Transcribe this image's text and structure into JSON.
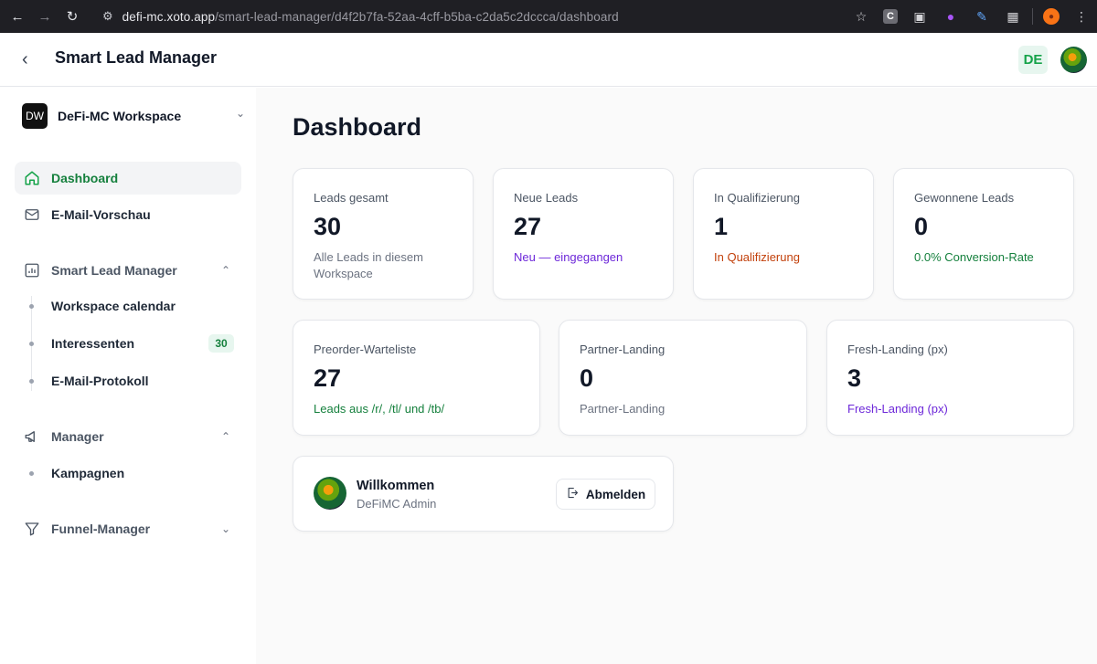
{
  "browser": {
    "url_host": "defi-mc.xoto.app",
    "url_path": "/smart-lead-manager/d4f2b7fa-52aa-4cff-b5ba-c2da5c2dccca/dashboard"
  },
  "header": {
    "title": "Smart Lead Manager",
    "language": "DE"
  },
  "sidebar": {
    "workspace": {
      "initials": "DW",
      "name": "DeFi-MC Workspace"
    },
    "items": [
      {
        "label": "Dashboard",
        "icon": "home-icon",
        "active": true
      },
      {
        "label": "E-Mail-Vorschau",
        "icon": "mail-icon"
      }
    ],
    "groups": [
      {
        "label": "Smart Lead Manager",
        "icon": "bar-chart-icon",
        "expanded": true,
        "items": [
          {
            "label": "Workspace calendar"
          },
          {
            "label": "Interessenten",
            "badge": "30"
          },
          {
            "label": "E-Mail-Protokoll"
          }
        ]
      },
      {
        "label": "Manager",
        "icon": "megaphone-icon",
        "expanded": true,
        "items": [
          {
            "label": "Kampagnen"
          }
        ]
      },
      {
        "label": "Funnel-Manager",
        "icon": "funnel-icon",
        "expanded": false,
        "items": []
      }
    ]
  },
  "main": {
    "title": "Dashboard",
    "stats_row1": [
      {
        "label": "Leads gesamt",
        "value": "30",
        "sub": "Alle Leads in diesem Workspace",
        "tone": "gray"
      },
      {
        "label": "Neue Leads",
        "value": "27",
        "sub": "Neu — eingegangen",
        "tone": "violet"
      },
      {
        "label": "In Qualifizierung",
        "value": "1",
        "sub": "In Qualifizierung",
        "tone": "orange"
      },
      {
        "label": "Gewonnene Leads",
        "value": "0",
        "sub": "0.0% Conversion-Rate",
        "tone": "green"
      }
    ],
    "stats_row2": [
      {
        "label": "Preorder-Warteliste",
        "value": "27",
        "sub": "Leads aus /r/, /tl/ und /tb/",
        "tone": "green"
      },
      {
        "label": "Partner-Landing",
        "value": "0",
        "sub": "Partner-Landing",
        "tone": "gray"
      },
      {
        "label": "Fresh-Landing (px)",
        "value": "3",
        "sub": "Fresh-Landing (px)",
        "tone": "violet"
      }
    ],
    "welcome": {
      "title": "Willkommen",
      "user": "DeFiMC Admin",
      "logout_label": "Abmelden"
    }
  }
}
